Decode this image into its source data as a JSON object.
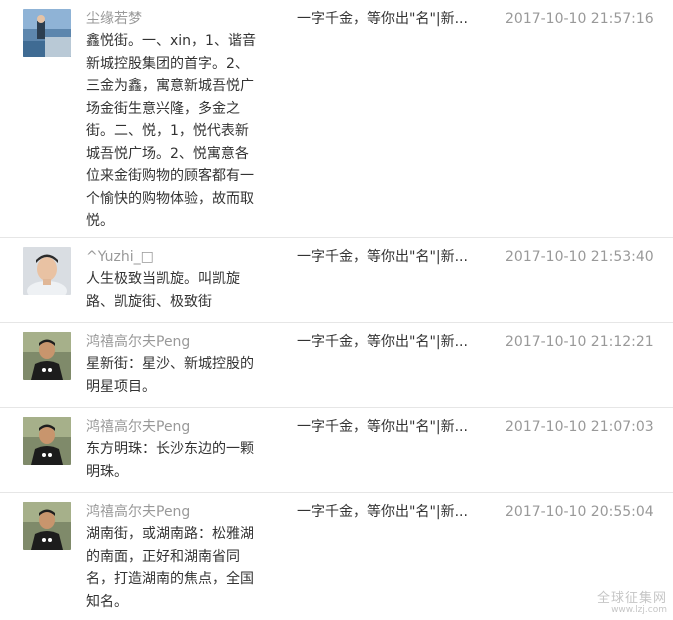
{
  "comments": [
    {
      "user": "尘缘若梦",
      "avatar_icon": "sea-landscape-avatar",
      "text": "鑫悦街。一、xin，1、谐音\n新城控股集团的首字。2、\n三金为鑫，寓意新城吾悦广\n场金街生意兴隆，多金之\n街。二、悦，1，悦代表新\n城吾悦广场。2、悦寓意各\n位来金街购物的顾客都有一\n个愉快的购物体验，故而取\n悦。",
      "article": "一字千金，等你出\"名\"|新...",
      "time": "2017-10-10 21:57:16"
    },
    {
      "user": "^Yuzhi_□",
      "avatar_icon": "young-man-portrait-avatar",
      "text": "人生极致当凯旋。叫凯旋\n路、凯旋街、极致街",
      "article": "一字千金，等你出\"名\"|新...",
      "time": "2017-10-10 21:53:40"
    },
    {
      "user": "鸿禧高尔夫Peng",
      "avatar_icon": "man-black-tshirt-avatar",
      "text": "星新街：星沙、新城控股的\n明星项目。",
      "article": "一字千金，等你出\"名\"|新...",
      "time": "2017-10-10 21:12:21"
    },
    {
      "user": "鸿禧高尔夫Peng",
      "avatar_icon": "man-black-tshirt-avatar",
      "text": "东方明珠：长沙东边的一颗\n明珠。",
      "article": "一字千金，等你出\"名\"|新...",
      "time": "2017-10-10 21:07:03"
    },
    {
      "user": "鸿禧高尔夫Peng",
      "avatar_icon": "man-black-tshirt-avatar",
      "text": "湖南街，或湖南路：松雅湖\n的南面，正好和湖南省同\n名，打造湖南的焦点，全国\n知名。",
      "article": "一字千金，等你出\"名\"|新...",
      "time": "2017-10-10 20:55:04"
    }
  ],
  "watermark": {
    "main": "全球征集网",
    "sub": "www.lzj.com"
  }
}
